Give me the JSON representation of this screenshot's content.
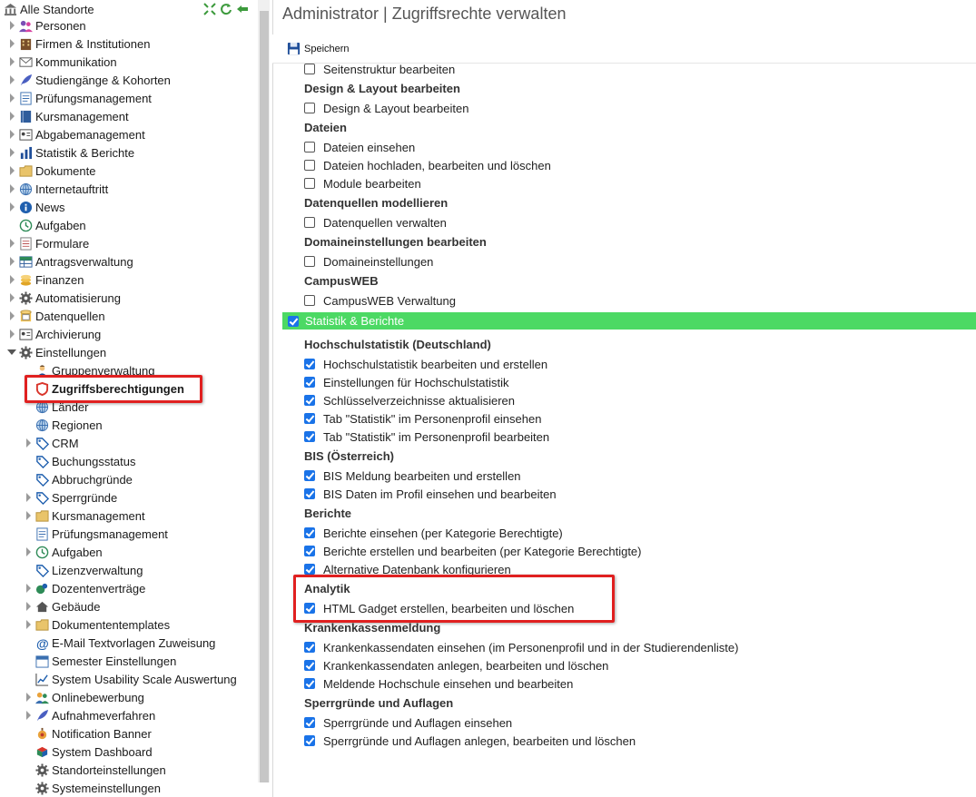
{
  "sidebar": {
    "root_label": "Alle Standorte",
    "items": [
      {
        "label": "Personen",
        "icon": "people-icon",
        "expander": "closed"
      },
      {
        "label": "Firmen & Institutionen",
        "icon": "building-icon",
        "expander": "closed"
      },
      {
        "label": "Kommunikation",
        "icon": "envelope-icon",
        "expander": "closed"
      },
      {
        "label": "Studiengänge & Kohorten",
        "icon": "feather-icon",
        "expander": "closed"
      },
      {
        "label": "Prüfungsmanagement",
        "icon": "checklist-icon",
        "expander": "closed"
      },
      {
        "label": "Kursmanagement",
        "icon": "book-icon",
        "expander": "closed"
      },
      {
        "label": "Abgabemanagement",
        "icon": "id-card-icon",
        "expander": "closed"
      },
      {
        "label": "Statistik & Berichte",
        "icon": "bar-chart-icon",
        "expander": "closed"
      },
      {
        "label": "Dokumente",
        "icon": "folder-icon",
        "expander": "closed"
      },
      {
        "label": "Internetauftritt",
        "icon": "globe-icon",
        "expander": "closed"
      },
      {
        "label": "News",
        "icon": "info-icon",
        "expander": "closed"
      },
      {
        "label": "Aufgaben",
        "icon": "clock-icon",
        "expander": "none"
      },
      {
        "label": "Formulare",
        "icon": "form-icon",
        "expander": "closed"
      },
      {
        "label": "Antragsverwaltung",
        "icon": "table-icon",
        "expander": "closed"
      },
      {
        "label": "Finanzen",
        "icon": "coins-icon",
        "expander": "closed"
      },
      {
        "label": "Automatisierung",
        "icon": "gear-icon",
        "expander": "closed"
      },
      {
        "label": "Datenquellen",
        "icon": "database-icon",
        "expander": "closed"
      },
      {
        "label": "Archivierung",
        "icon": "archive-icon",
        "expander": "closed"
      },
      {
        "label": "Einstellungen",
        "icon": "gear-icon",
        "expander": "open"
      }
    ],
    "sub_items": [
      {
        "label": "Gruppenverwaltung",
        "icon": "user-group-icon",
        "expander": "none"
      },
      {
        "label": "Zugriffsberechtigungen",
        "icon": "shield-icon",
        "expander": "none",
        "selected": true
      },
      {
        "label": "Länder",
        "icon": "globe-icon",
        "expander": "none"
      },
      {
        "label": "Regionen",
        "icon": "globe-icon",
        "expander": "none"
      },
      {
        "label": "CRM",
        "icon": "tag-icon",
        "expander": "closed"
      },
      {
        "label": "Buchungsstatus",
        "icon": "tag-icon",
        "expander": "none"
      },
      {
        "label": "Abbruchgründe",
        "icon": "tag-icon",
        "expander": "none"
      },
      {
        "label": "Sperrgründe",
        "icon": "tag-icon",
        "expander": "closed"
      },
      {
        "label": "Kursmanagement",
        "icon": "folder-icon",
        "expander": "closed"
      },
      {
        "label": "Prüfungsmanagement",
        "icon": "checklist-icon",
        "expander": "none"
      },
      {
        "label": "Aufgaben",
        "icon": "clock-icon",
        "expander": "closed"
      },
      {
        "label": "Lizenzverwaltung",
        "icon": "tag-icon",
        "expander": "none"
      },
      {
        "label": "Dozentenverträge",
        "icon": "contract-icon",
        "expander": "closed"
      },
      {
        "label": "Gebäude",
        "icon": "house-icon",
        "expander": "closed"
      },
      {
        "label": "Dokumententemplates",
        "icon": "folder-icon",
        "expander": "closed"
      },
      {
        "label": "E-Mail Textvorlagen Zuweisung",
        "icon": "at-icon",
        "expander": "none"
      },
      {
        "label": "Semester Einstellungen",
        "icon": "calendar-icon",
        "expander": "none"
      },
      {
        "label": "System Usability Scale Auswertung",
        "icon": "line-chart-icon",
        "expander": "none"
      },
      {
        "label": "Onlinebewerbung",
        "icon": "users-icon",
        "expander": "closed"
      },
      {
        "label": "Aufnahmeverfahren",
        "icon": "feather-icon",
        "expander": "closed"
      },
      {
        "label": "Notification Banner",
        "icon": "bell-icon",
        "expander": "none"
      },
      {
        "label": "System Dashboard",
        "icon": "dashboard-icon",
        "expander": "none"
      },
      {
        "label": "Standorteinstellungen",
        "icon": "gear-icon",
        "expander": "none"
      },
      {
        "label": "Systemeinstellungen",
        "icon": "gear-icon",
        "expander": "none"
      }
    ]
  },
  "header": {
    "title": "Administrator | Zugriffsrechte verwalten"
  },
  "toolbar": {
    "save_label": "Speichern"
  },
  "permissions": {
    "top_partial": {
      "label": "Seitenstruktur bearbeiten",
      "checked": false
    },
    "groups_before": [
      {
        "title": "Design & Layout bearbeiten",
        "items": [
          {
            "label": "Design & Layout bearbeiten",
            "checked": false
          }
        ]
      },
      {
        "title": "Dateien",
        "items": [
          {
            "label": "Dateien einsehen",
            "checked": false
          },
          {
            "label": "Dateien hochladen, bearbeiten und löschen",
            "checked": false
          },
          {
            "label": "Module bearbeiten",
            "checked": false
          }
        ]
      },
      {
        "title": "Datenquellen modellieren",
        "items": [
          {
            "label": "Datenquellen verwalten",
            "checked": false
          }
        ]
      },
      {
        "title": "Domaineinstellungen bearbeiten",
        "items": [
          {
            "label": "Domaineinstellungen",
            "checked": false
          }
        ]
      },
      {
        "title": "CampusWEB",
        "items": [
          {
            "label": "CampusWEB Verwaltung",
            "checked": false
          }
        ]
      }
    ],
    "module": {
      "label": "Statistik & Berichte",
      "checked": true
    },
    "groups_after": [
      {
        "title": "Hochschulstatistik (Deutschland)",
        "items": [
          {
            "label": "Hochschulstatistik bearbeiten und erstellen",
            "checked": true
          },
          {
            "label": "Einstellungen für Hochschulstatistik",
            "checked": true
          },
          {
            "label": "Schlüsselverzeichnisse aktualisieren",
            "checked": true
          },
          {
            "label": "Tab \"Statistik\" im Personenprofil einsehen",
            "checked": true
          },
          {
            "label": "Tab \"Statistik\" im Personenprofil bearbeiten",
            "checked": true
          }
        ]
      },
      {
        "title": "BIS (Österreich)",
        "items": [
          {
            "label": "BIS Meldung bearbeiten und erstellen",
            "checked": true
          },
          {
            "label": "BIS Daten im Profil einsehen und bearbeiten",
            "checked": true
          }
        ]
      },
      {
        "title": "Berichte",
        "items": [
          {
            "label": "Berichte einsehen (per Kategorie Berechtigte)",
            "checked": true
          },
          {
            "label": "Berichte erstellen und bearbeiten (per Kategorie Berechtigte)",
            "checked": true
          },
          {
            "label": "Alternative Datenbank konfigurieren",
            "checked": true
          }
        ]
      },
      {
        "title": "Analytik",
        "items": [
          {
            "label": "HTML Gadget erstellen, bearbeiten und löschen",
            "checked": true
          }
        ]
      },
      {
        "title": "Krankenkassenmeldung",
        "items": [
          {
            "label": "Krankenkassendaten einsehen (im Personenprofil und in der Studierendenliste)",
            "checked": true
          },
          {
            "label": "Krankenkassendaten anlegen, bearbeiten und löschen",
            "checked": true
          },
          {
            "label": "Meldende Hochschule einsehen und bearbeiten",
            "checked": true
          }
        ]
      },
      {
        "title": "Sperrgründe und Auflagen",
        "items": [
          {
            "label": "Sperrgründe und Auflagen einsehen",
            "checked": true
          },
          {
            "label": "Sperrgründe und Auflagen anlegen, bearbeiten und löschen",
            "checked": true
          }
        ]
      }
    ]
  },
  "colors": {
    "module_bar": "#4cd964",
    "checkbox_checked": "#1a73e8",
    "highlight": "#e02020"
  }
}
